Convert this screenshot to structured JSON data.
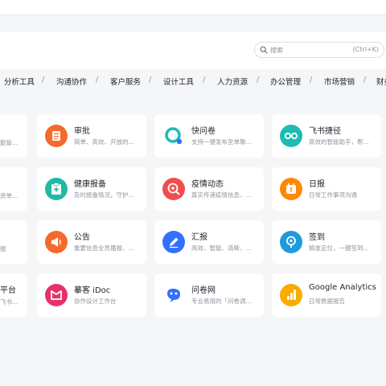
{
  "search": {
    "placeholder": "搜索",
    "shortcut": "(Ctrl+K)"
  },
  "categories": [
    "分析工具",
    "沟通协作",
    "客户服务",
    "设计工具",
    "人力资源",
    "办公管理",
    "市场营销",
    "财务"
  ],
  "category_separator": "/",
  "partial_left_cards": [
    {
      "name": "",
      "desc": "勤管..."
    },
    {
      "name": "",
      "desc": "资单..."
    },
    {
      "name": "",
      "desc": "报"
    },
    {
      "name": "平台",
      "desc": "飞书..."
    }
  ],
  "apps": [
    {
      "name": "审批",
      "desc": "简单、高效、开放的...",
      "icon": "approval-icon",
      "color": "#f5692c"
    },
    {
      "name": "快问卷",
      "desc": "支持一键发布至单聊...",
      "icon": "survey-icon",
      "color": "#ffffff"
    },
    {
      "name": "飞书捷径",
      "desc": "高效的智能助手，帮...",
      "icon": "shortcut-icon",
      "color": "#1fbbb3"
    },
    {
      "name": "健康报备",
      "desc": "及时报备情况，守护...",
      "icon": "health-report-icon",
      "color": "#20b9a3"
    },
    {
      "name": "疫情动态",
      "desc": "真实传递疫情信息、...",
      "icon": "epidemic-icon",
      "color": "#f04e4e"
    },
    {
      "name": "日报",
      "desc": "日常工作事项沟通",
      "icon": "daily-report-icon",
      "color": "#ff8800"
    },
    {
      "name": "公告",
      "desc": "重要信息全员播报、...",
      "icon": "announcement-icon",
      "color": "#f5692c"
    },
    {
      "name": "汇报",
      "desc": "高效、智能、清晰、...",
      "icon": "report-icon",
      "color": "#3370ff"
    },
    {
      "name": "签到",
      "desc": "精准定位，一键签到...",
      "icon": "check-in-icon",
      "color": "#1e9bdb"
    },
    {
      "name": "摹客 iDoc",
      "desc": "协作设计工作台",
      "icon": "idoc-icon",
      "color": "#e5326b"
    },
    {
      "name": "问卷网",
      "desc": "专业易用的「问卷调...",
      "icon": "wenjuan-icon",
      "color": "#ffffff"
    },
    {
      "name": "Google Analytics",
      "desc": "日常数据报告",
      "icon": "google-analytics-icon",
      "color": "#f9ab00"
    }
  ]
}
